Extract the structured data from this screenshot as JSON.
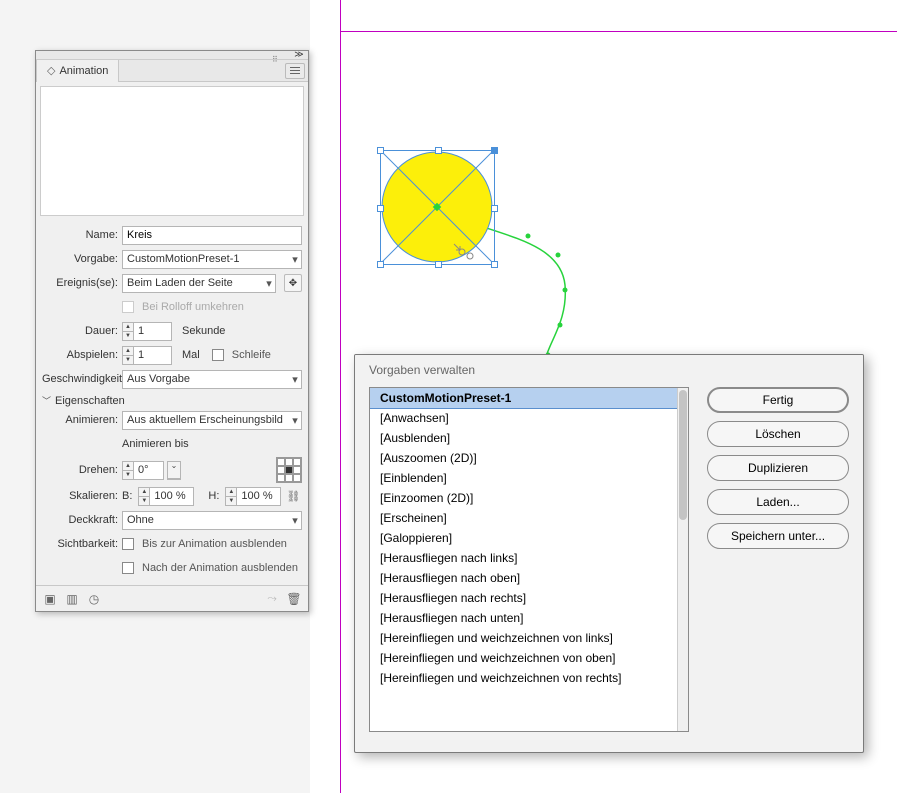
{
  "panel": {
    "title": "Animation",
    "name_label": "Name:",
    "name_value": "Kreis",
    "preset_label": "Vorgabe:",
    "preset_value": "CustomMotionPreset-1",
    "events_label": "Ereignis(se):",
    "events_value": "Beim Laden der Seite",
    "reverse_rolloff": "Bei Rolloff umkehren",
    "duration_label": "Dauer:",
    "duration_value": "1",
    "duration_unit": "Sekunde",
    "play_label": "Abspielen:",
    "play_value": "1",
    "play_unit": "Mal",
    "loop_label": "Schleife",
    "speed_label": "Geschwindigkeit:",
    "speed_value": "Aus Vorgabe",
    "properties_header": "Eigenschaften",
    "animate_label": "Animieren:",
    "animate_value": "Aus aktuellem Erscheinungsbild",
    "animate_to": "Animieren bis",
    "rotate_label": "Drehen:",
    "rotate_value": "0°",
    "scale_label": "Skalieren:",
    "scale_w_lbl": "B:",
    "scale_w": "100 %",
    "scale_h_lbl": "H:",
    "scale_h": "100 %",
    "opacity_label": "Deckkraft:",
    "opacity_value": "Ohne",
    "visibility_label": "Sichtbarkeit:",
    "vis_before": "Bis zur Animation ausblenden",
    "vis_after": "Nach der Animation ausblenden"
  },
  "dialog": {
    "title": "Vorgaben verwalten",
    "buttons": {
      "done": "Fertig",
      "delete": "Löschen",
      "duplicate": "Duplizieren",
      "load": "Laden...",
      "save_as": "Speichern unter..."
    },
    "presets": [
      "CustomMotionPreset-1",
      "[Anwachsen]",
      "[Ausblenden]",
      "[Auszoomen (2D)]",
      "[Einblenden]",
      "[Einzoomen (2D)]",
      "[Erscheinen]",
      "[Galoppieren]",
      "[Herausfliegen nach links]",
      "[Herausfliegen nach oben]",
      "[Herausfliegen nach rechts]",
      "[Herausfliegen nach unten]",
      "[Hereinfliegen und weichzeichnen von links]",
      "[Hereinfliegen und weichzeichnen von oben]",
      "[Hereinfliegen und weichzeichnen von rechts]"
    ],
    "selected_index": 0
  }
}
